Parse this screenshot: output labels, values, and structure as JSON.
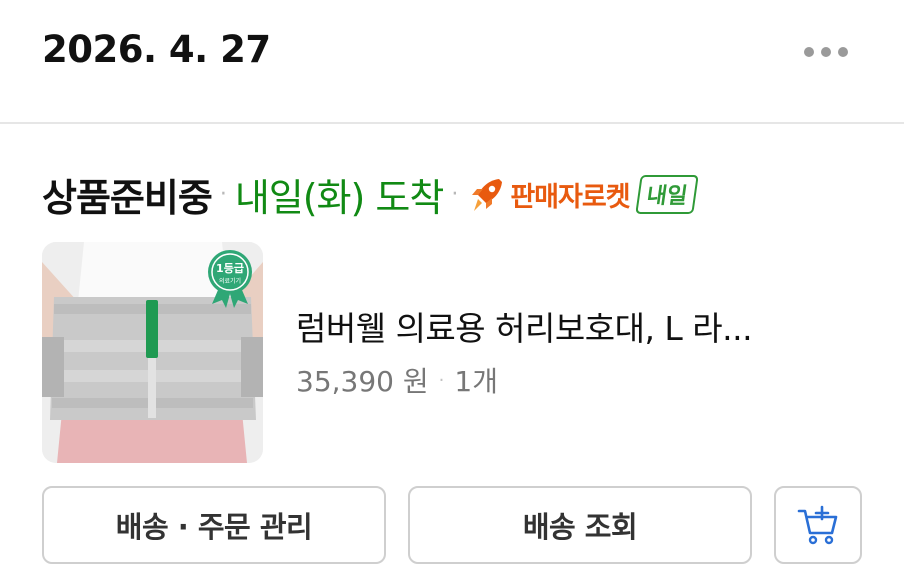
{
  "header": {
    "date": "2026. 4. 27",
    "more_icon": "more-horizontal-icon"
  },
  "order": {
    "status": "상품준비중",
    "separator": "·",
    "arrival": "내일(화) 도착",
    "delivery_badge": {
      "icon": "rocket-icon",
      "label": "판매자로켓",
      "tag": "내일"
    }
  },
  "product": {
    "name": "럼버웰 의료용 허리보호대, L 라...",
    "price": "35,390 원",
    "quantity": "1개",
    "badge_text": "1등급",
    "badge_subtext": "의료기기"
  },
  "actions": {
    "manage_label": "배송 · 주문 관리",
    "track_label": "배송 조회",
    "cart_icon": "add-to-cart-icon"
  },
  "colors": {
    "arrival_green": "#118a14",
    "rocket_orange": "#e85a0f",
    "tag_green": "#2f9a37",
    "cart_blue": "#2a6fd6"
  }
}
